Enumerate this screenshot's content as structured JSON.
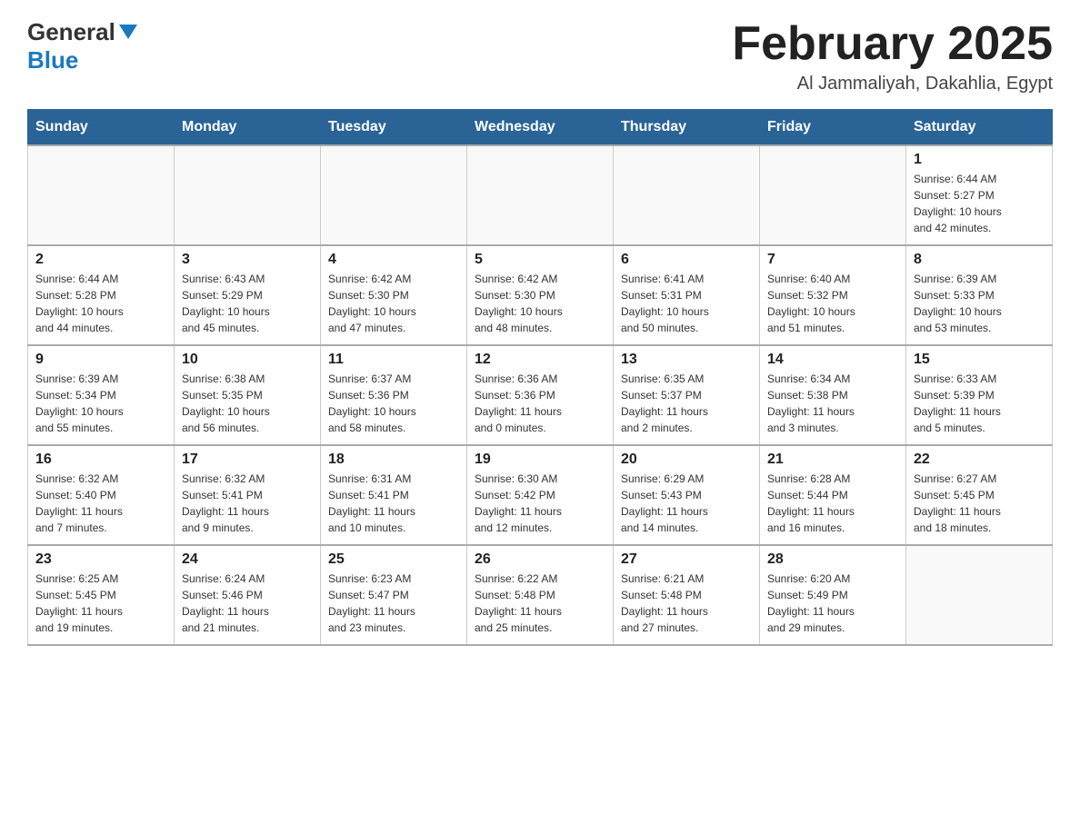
{
  "logo": {
    "general": "General",
    "triangle": "▲",
    "blue": "Blue"
  },
  "header": {
    "month_title": "February 2025",
    "location": "Al Jammaliyah, Dakahlia, Egypt"
  },
  "weekdays": [
    "Sunday",
    "Monday",
    "Tuesday",
    "Wednesday",
    "Thursday",
    "Friday",
    "Saturday"
  ],
  "weeks": [
    [
      {
        "day": "",
        "info": ""
      },
      {
        "day": "",
        "info": ""
      },
      {
        "day": "",
        "info": ""
      },
      {
        "day": "",
        "info": ""
      },
      {
        "day": "",
        "info": ""
      },
      {
        "day": "",
        "info": ""
      },
      {
        "day": "1",
        "info": "Sunrise: 6:44 AM\nSunset: 5:27 PM\nDaylight: 10 hours\nand 42 minutes."
      }
    ],
    [
      {
        "day": "2",
        "info": "Sunrise: 6:44 AM\nSunset: 5:28 PM\nDaylight: 10 hours\nand 44 minutes."
      },
      {
        "day": "3",
        "info": "Sunrise: 6:43 AM\nSunset: 5:29 PM\nDaylight: 10 hours\nand 45 minutes."
      },
      {
        "day": "4",
        "info": "Sunrise: 6:42 AM\nSunset: 5:30 PM\nDaylight: 10 hours\nand 47 minutes."
      },
      {
        "day": "5",
        "info": "Sunrise: 6:42 AM\nSunset: 5:30 PM\nDaylight: 10 hours\nand 48 minutes."
      },
      {
        "day": "6",
        "info": "Sunrise: 6:41 AM\nSunset: 5:31 PM\nDaylight: 10 hours\nand 50 minutes."
      },
      {
        "day": "7",
        "info": "Sunrise: 6:40 AM\nSunset: 5:32 PM\nDaylight: 10 hours\nand 51 minutes."
      },
      {
        "day": "8",
        "info": "Sunrise: 6:39 AM\nSunset: 5:33 PM\nDaylight: 10 hours\nand 53 minutes."
      }
    ],
    [
      {
        "day": "9",
        "info": "Sunrise: 6:39 AM\nSunset: 5:34 PM\nDaylight: 10 hours\nand 55 minutes."
      },
      {
        "day": "10",
        "info": "Sunrise: 6:38 AM\nSunset: 5:35 PM\nDaylight: 10 hours\nand 56 minutes."
      },
      {
        "day": "11",
        "info": "Sunrise: 6:37 AM\nSunset: 5:36 PM\nDaylight: 10 hours\nand 58 minutes."
      },
      {
        "day": "12",
        "info": "Sunrise: 6:36 AM\nSunset: 5:36 PM\nDaylight: 11 hours\nand 0 minutes."
      },
      {
        "day": "13",
        "info": "Sunrise: 6:35 AM\nSunset: 5:37 PM\nDaylight: 11 hours\nand 2 minutes."
      },
      {
        "day": "14",
        "info": "Sunrise: 6:34 AM\nSunset: 5:38 PM\nDaylight: 11 hours\nand 3 minutes."
      },
      {
        "day": "15",
        "info": "Sunrise: 6:33 AM\nSunset: 5:39 PM\nDaylight: 11 hours\nand 5 minutes."
      }
    ],
    [
      {
        "day": "16",
        "info": "Sunrise: 6:32 AM\nSunset: 5:40 PM\nDaylight: 11 hours\nand 7 minutes."
      },
      {
        "day": "17",
        "info": "Sunrise: 6:32 AM\nSunset: 5:41 PM\nDaylight: 11 hours\nand 9 minutes."
      },
      {
        "day": "18",
        "info": "Sunrise: 6:31 AM\nSunset: 5:41 PM\nDaylight: 11 hours\nand 10 minutes."
      },
      {
        "day": "19",
        "info": "Sunrise: 6:30 AM\nSunset: 5:42 PM\nDaylight: 11 hours\nand 12 minutes."
      },
      {
        "day": "20",
        "info": "Sunrise: 6:29 AM\nSunset: 5:43 PM\nDaylight: 11 hours\nand 14 minutes."
      },
      {
        "day": "21",
        "info": "Sunrise: 6:28 AM\nSunset: 5:44 PM\nDaylight: 11 hours\nand 16 minutes."
      },
      {
        "day": "22",
        "info": "Sunrise: 6:27 AM\nSunset: 5:45 PM\nDaylight: 11 hours\nand 18 minutes."
      }
    ],
    [
      {
        "day": "23",
        "info": "Sunrise: 6:25 AM\nSunset: 5:45 PM\nDaylight: 11 hours\nand 19 minutes."
      },
      {
        "day": "24",
        "info": "Sunrise: 6:24 AM\nSunset: 5:46 PM\nDaylight: 11 hours\nand 21 minutes."
      },
      {
        "day": "25",
        "info": "Sunrise: 6:23 AM\nSunset: 5:47 PM\nDaylight: 11 hours\nand 23 minutes."
      },
      {
        "day": "26",
        "info": "Sunrise: 6:22 AM\nSunset: 5:48 PM\nDaylight: 11 hours\nand 25 minutes."
      },
      {
        "day": "27",
        "info": "Sunrise: 6:21 AM\nSunset: 5:48 PM\nDaylight: 11 hours\nand 27 minutes."
      },
      {
        "day": "28",
        "info": "Sunrise: 6:20 AM\nSunset: 5:49 PM\nDaylight: 11 hours\nand 29 minutes."
      },
      {
        "day": "",
        "info": ""
      }
    ]
  ]
}
